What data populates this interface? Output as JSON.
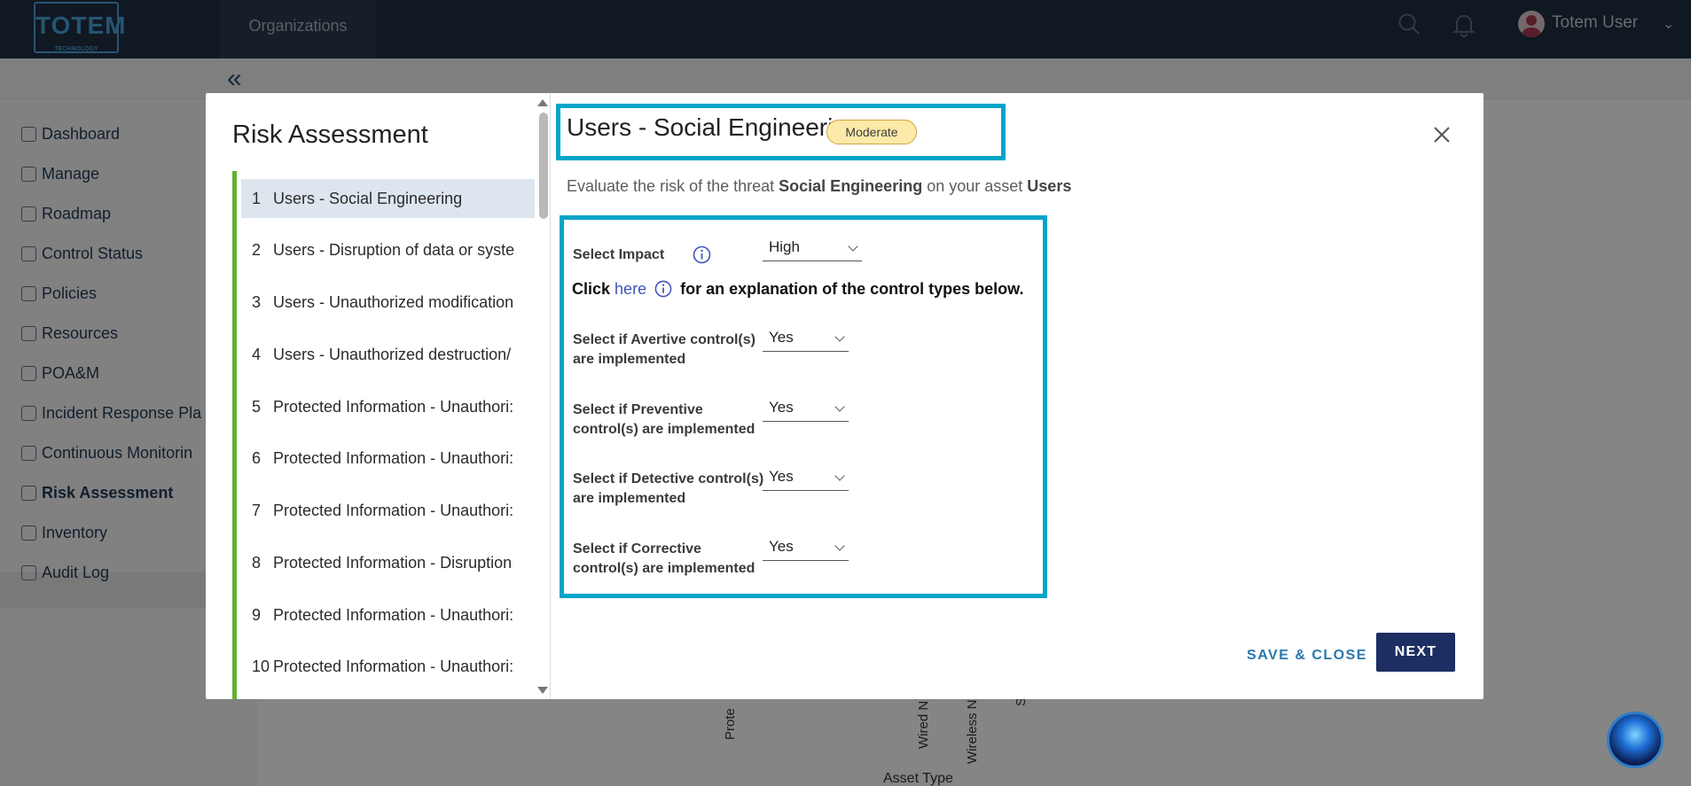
{
  "app": {
    "logo_text": "TOTEM",
    "logo_subtext": "TECHNOLOGY",
    "org_tab": "Organizations",
    "user_name": "Totem User"
  },
  "sidebar": {
    "items": [
      {
        "label": "Dashboard",
        "icon": "dashboard-icon"
      },
      {
        "label": "Manage",
        "icon": "gear-icon"
      },
      {
        "label": "Roadmap",
        "icon": "roadmap-icon"
      },
      {
        "label": "Control Status",
        "icon": "check-icon"
      },
      {
        "label": "Policies",
        "icon": "document-icon"
      },
      {
        "label": "Resources",
        "icon": "briefcase-icon"
      },
      {
        "label": "POA&M",
        "icon": "clipboard-icon"
      },
      {
        "label": "Incident Response Pla",
        "icon": "incident-icon"
      },
      {
        "label": "Continuous Monitorin",
        "icon": "monitoring-icon"
      },
      {
        "label": "Risk Assessment",
        "icon": "warning-icon"
      },
      {
        "label": "Inventory",
        "icon": "inventory-icon"
      },
      {
        "label": "Audit Log",
        "icon": "history-icon"
      }
    ]
  },
  "background": {
    "axis_label": "Asset Type",
    "vertical_labels": [
      "Prote",
      "Wired N",
      "Wireless N",
      "S"
    ]
  },
  "modal": {
    "left_title": "Risk Assessment",
    "steps": [
      {
        "num": "1",
        "label": "Users - Social Engineering"
      },
      {
        "num": "2",
        "label": "Users - Disruption of data or syste"
      },
      {
        "num": "3",
        "label": "Users - Unauthorized modification"
      },
      {
        "num": "4",
        "label": "Users - Unauthorized destruction/"
      },
      {
        "num": "5",
        "label": "Protected Information - Unauthori:"
      },
      {
        "num": "6",
        "label": "Protected Information - Unauthori:"
      },
      {
        "num": "7",
        "label": "Protected Information - Unauthori:"
      },
      {
        "num": "8",
        "label": "Protected Information - Disruption"
      },
      {
        "num": "9",
        "label": "Protected Information - Unauthori:"
      },
      {
        "num": "10",
        "label": "Protected Information - Unauthori:"
      }
    ],
    "title": "Users - Social Engineering",
    "badge": "Moderate",
    "subtitle_prefix": "Evaluate the risk of the threat",
    "subtitle_threat": "Social Engineering",
    "subtitle_mid": "on your asset",
    "subtitle_asset": "Users",
    "impact_label": "Select Impact",
    "impact_value": "High",
    "click_prefix": "Click",
    "click_link": "here",
    "click_suffix": "for an explanation of the control types below.",
    "controls": [
      {
        "line1": "Select if Avertive control(s)",
        "line2": "are implemented",
        "value": "Yes"
      },
      {
        "line1": "Select if Preventive",
        "line2": "control(s) are implemented",
        "value": "Yes"
      },
      {
        "line1": "Select if Detective control(s)",
        "line2": "are implemented",
        "value": "Yes"
      },
      {
        "line1": "Select if Corrective",
        "line2": "control(s) are implemented",
        "value": "Yes"
      }
    ],
    "save_close": "SAVE & CLOSE",
    "next": "NEXT"
  },
  "colors": {
    "highlight": "#02a5c9",
    "primary_button": "#1d2e63",
    "step_rail": "#62b22f",
    "badge_bg": "#fbeaa8"
  }
}
